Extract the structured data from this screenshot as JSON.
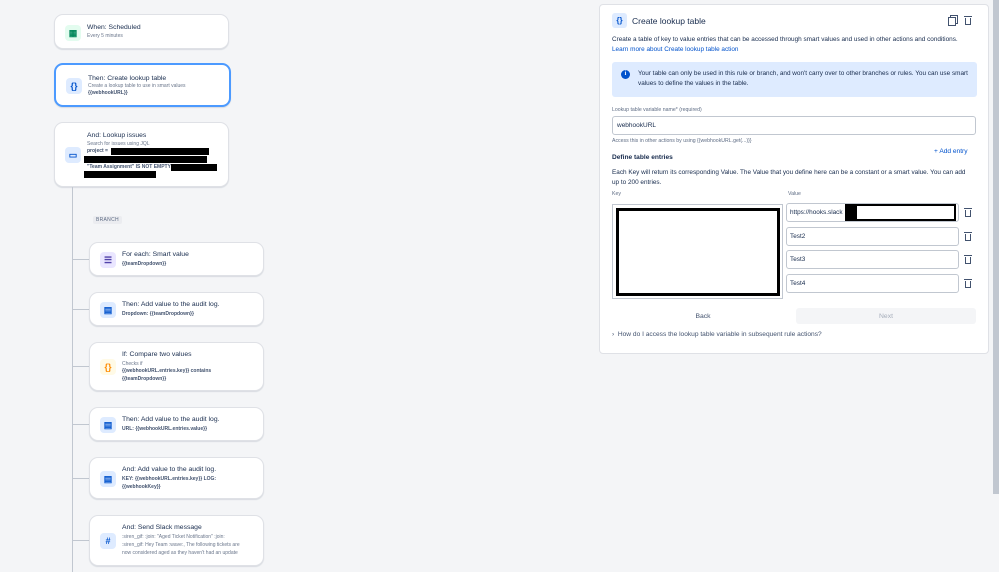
{
  "workflow": {
    "trigger": {
      "title": "When: Scheduled",
      "subtitle": "Every 5 minutes"
    },
    "lookup_table": {
      "title": "Then: Create lookup table",
      "subtitle": "Create a lookup table to use in smart values",
      "value": "{{webhookURL}}"
    },
    "lookup_issues": {
      "title": "And: Lookup issues",
      "subtitle": "Search for issues using JQL",
      "line1": "project =",
      "line3": "\"Team Assignment\" IS NOT EMPTY"
    },
    "branch_label": "BRANCH",
    "for_each": {
      "title": "For each: Smart value",
      "value": "{{teamDropdown}}"
    },
    "audit1": {
      "title": "Then: Add value to the audit log.",
      "value": "Dropdown: {{teamDropdown}}"
    },
    "compare": {
      "title": "If: Compare two values",
      "subtitle": "Checks if",
      "line1": "{{webhookURL.entries.key}} contains",
      "line2": "{{teamDropdown}}"
    },
    "audit2": {
      "title": "Then: Add value to the audit log.",
      "value": "URL: {{webhookURL.entries.value}}"
    },
    "audit3": {
      "title": "And: Add value to the audit log.",
      "line1": "KEY: {{webhookURL.entries.key}} LOG:",
      "line2": "{{webhookKey}}"
    },
    "slack": {
      "title": "And: Send Slack message",
      "line1": ":siren_gif: :join: \"Aged Ticket Notification\" :join:",
      "line2": ":siren_gif: Hey Team :wave:, The following tickets are",
      "line3": "now considered aged as they haven't had an update"
    }
  },
  "panel": {
    "title": "Create lookup table",
    "description": "Create a table of key to value entries that can be accessed through smart values and used in other actions and conditions.",
    "learn_more": "Learn more about Create lookup table action",
    "info": "Your table can only be used in this rule or branch, and won't carry over to other branches or rules. You can use smart values to define the values in the table.",
    "variable_label": "Lookup table variable name* (required)",
    "variable_value": "webhookURL",
    "variable_help": "Access this in other actions by using {{webhookURL.get(...)}}",
    "entries_heading": "Define table entries",
    "add_entry": "+ Add entry",
    "entries_desc": "Each Key will return its corresponding Value. The Value that you define here can be a constant or a smart value. You can add up to 200 entries.",
    "key_header": "Key",
    "value_header": "Value",
    "values": [
      "https://hooks.slack",
      "Test2",
      "Test3",
      "Test4"
    ],
    "back": "Back",
    "next": "Next",
    "faq": "How do I access the lookup table variable in subsequent rule actions?"
  },
  "icons": {
    "trigger": "calendar-icon",
    "lookup": "braces-icon",
    "issues": "monitor-icon",
    "foreach": "list-icon",
    "audit": "document-icon",
    "compare": "braces-icon",
    "slack": "slack-icon"
  },
  "colors": {
    "accent": "#0052cc",
    "selected_border": "#4c9aff",
    "info_bg": "#deebff"
  }
}
